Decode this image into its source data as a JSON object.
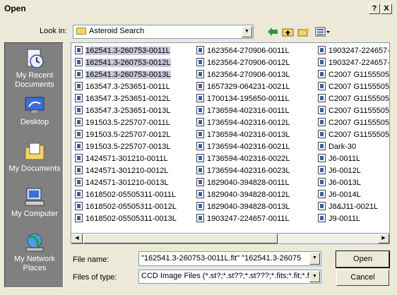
{
  "window": {
    "title": "Open",
    "help_button": "?",
    "close_button": "X"
  },
  "lookin": {
    "label": "Look in:",
    "value": "Asteroid Search"
  },
  "places": [
    {
      "label": "My Recent Documents",
      "icon": "recent-documents-icon"
    },
    {
      "label": "Desktop",
      "icon": "desktop-icon"
    },
    {
      "label": "My Documents",
      "icon": "my-documents-icon"
    },
    {
      "label": "My Computer",
      "icon": "my-computer-icon"
    },
    {
      "label": "My Network Places",
      "icon": "network-places-icon"
    }
  ],
  "files": {
    "col1": [
      "162541.3-260753-0011L",
      "162541.3-260753-0012L",
      "162541.3-260753-0013L",
      "163547.3-253651-0011L",
      "163547.3-253651-0012L",
      "163547.3-253651-0013L",
      "191503.5-225707-0011L",
      "191503.5-225707-0012L",
      "191503.5-225707-0013L",
      "1424571-301210-0011L",
      "1424571-301210-0012L",
      "1424571-301210-0013L",
      "1618502-05505311-0011L",
      "1618502-05505311-0012L",
      "1618502-05505311-0013L"
    ],
    "col2": [
      "1623564-270906-0011L",
      "1623564-270906-0012L",
      "1623564-270906-0013L",
      "1657329-064231-0021L",
      "1700134-195650-0011L",
      "1736594-402316-0011L",
      "1736594-402316-0012L",
      "1736594-402316-0013L",
      "1736594-402316-0021L",
      "1736594-402316-0022L",
      "1736594-402316-0023L",
      "1829040-394828-0011L",
      "1829040-394828-0012L",
      "1829040-394828-0013L",
      "1903247-224657-0011L"
    ],
    "col3": [
      "1903247-224657-",
      "1903247-224657-",
      "C2007 G1155505",
      "C2007 G1155505",
      "C2007 G1155505",
      "C2007 G1155505",
      "C2007 G1155505",
      "C2007 G1155505",
      "Dark-30",
      "J6-0011L",
      "J6-0012L",
      "J6-0013L",
      "J6-0014L",
      "J8&J11-0021L",
      "J9-0011L"
    ],
    "selected_count": 3
  },
  "filename": {
    "label": "File name:",
    "value": "\"162541.3-260753-0011L.fit\" \"162541.3-26075"
  },
  "filetype": {
    "label": "Files of type:",
    "value": "CCD Image Files  (*.st?;*.st??;*.st???;*.fits;*.fit;*.f"
  },
  "buttons": {
    "open": "Open",
    "cancel": "Cancel"
  }
}
